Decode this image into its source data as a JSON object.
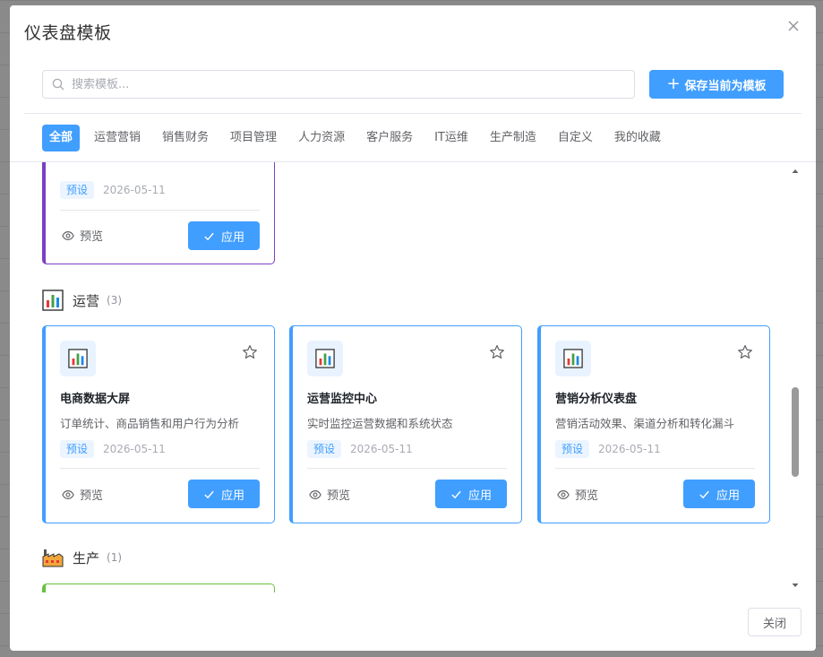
{
  "dialog": {
    "title": "仪表盘模板",
    "close_button": "关闭"
  },
  "search": {
    "placeholder": "搜索模板..."
  },
  "save_button": {
    "label": "保存当前为模板"
  },
  "tabs": [
    {
      "label": "全部",
      "active": true
    },
    {
      "label": "运营营销"
    },
    {
      "label": "销售财务"
    },
    {
      "label": "项目管理"
    },
    {
      "label": "人力资源"
    },
    {
      "label": "客户服务"
    },
    {
      "label": "IT运维"
    },
    {
      "label": "生产制造"
    },
    {
      "label": "自定义"
    },
    {
      "label": "我的收藏"
    }
  ],
  "partial_card": {
    "tag": "预设",
    "date": "2026-05-11",
    "preview": "预览",
    "apply": "应用",
    "accent_color": "#7b3fc4"
  },
  "sections": {
    "operations": {
      "icon": "bar-chart-icon",
      "title": "运营",
      "count": "(3)",
      "cards": [
        {
          "name": "电商数据大屏",
          "desc": "订单统计、商品销售和用户行为分析",
          "tag": "预设",
          "date": "2026-05-11",
          "preview": "预览",
          "apply": "应用"
        },
        {
          "name": "运营监控中心",
          "desc": "实时监控运营数据和系统状态",
          "tag": "预设",
          "date": "2026-05-11",
          "preview": "预览",
          "apply": "应用"
        },
        {
          "name": "营销分析仪表盘",
          "desc": "营销活动效果、渠道分析和转化漏斗",
          "tag": "预设",
          "date": "2026-05-11",
          "preview": "预览",
          "apply": "应用"
        }
      ]
    },
    "production": {
      "icon": "factory-icon",
      "title": "生产",
      "count": "(1)",
      "accent_color": "#67c23a"
    }
  },
  "colors": {
    "primary": "#409eff",
    "tag_bg": "#ecf5ff"
  }
}
